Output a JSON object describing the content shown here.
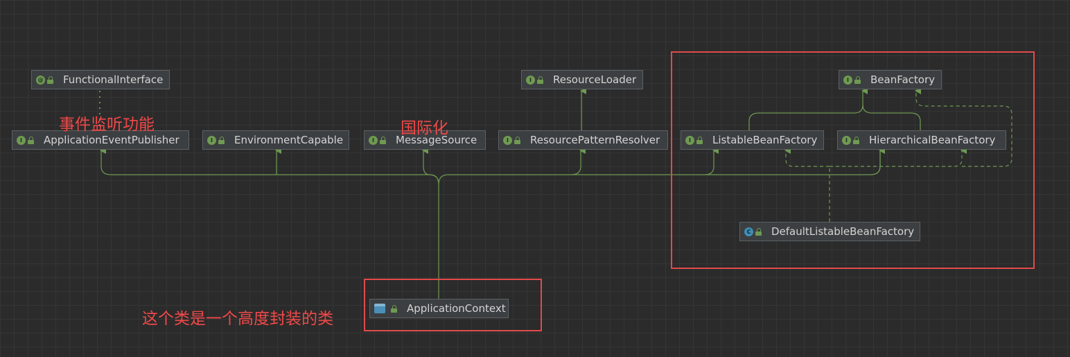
{
  "colors": {
    "background": "#2b2b2b",
    "node_fill": "#3c3f41",
    "node_text": "#d4d4d4",
    "edge": "#6f9a52",
    "annotation_red": "#e34a4a"
  },
  "nodes": {
    "functional_interface": {
      "label": "FunctionalInterface",
      "kind": "annotation",
      "icon": "annotation-icon"
    },
    "application_event_publisher": {
      "label": "ApplicationEventPublisher",
      "kind": "interface",
      "icon": "interface-icon"
    },
    "environment_capable": {
      "label": "EnvironmentCapable",
      "kind": "interface",
      "icon": "interface-icon"
    },
    "message_source": {
      "label": "MessageSource",
      "kind": "interface",
      "icon": "interface-icon"
    },
    "resource_loader": {
      "label": "ResourceLoader",
      "kind": "interface",
      "icon": "interface-icon"
    },
    "resource_pattern_resolver": {
      "label": "ResourcePatternResolver",
      "kind": "interface",
      "icon": "interface-icon"
    },
    "bean_factory": {
      "label": "BeanFactory",
      "kind": "interface",
      "icon": "interface-icon"
    },
    "listable_bean_factory": {
      "label": "ListableBeanFactory",
      "kind": "interface",
      "icon": "interface-icon"
    },
    "hierarchical_bean_factory": {
      "label": "HierarchicalBeanFactory",
      "kind": "interface",
      "icon": "interface-icon"
    },
    "default_listable_bean_factory": {
      "label": "DefaultListableBeanFactory",
      "kind": "class",
      "icon": "class-icon"
    },
    "application_context": {
      "label": "ApplicationContext",
      "kind": "interface",
      "icon": "application-context-icon"
    }
  },
  "notes": {
    "event_listening": "事件监听功能",
    "i18n": "国际化",
    "highly_encapsulated": "这个类是一个高度封装的类"
  }
}
